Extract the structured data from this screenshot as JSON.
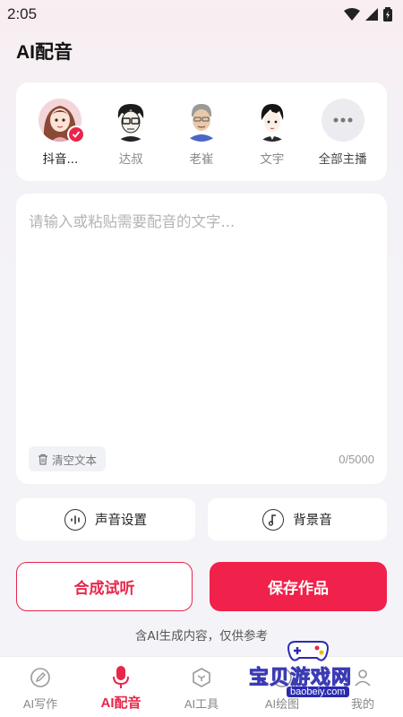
{
  "status": {
    "time": "2:05"
  },
  "header": {
    "title": "AI配音"
  },
  "voices": [
    {
      "name": "抖音...",
      "selected": true,
      "avatar": "female-anime-avatar"
    },
    {
      "name": "达叔",
      "selected": false,
      "avatar": "glasses-man-avatar"
    },
    {
      "name": "老崔",
      "selected": false,
      "avatar": "gray-hair-man-avatar"
    },
    {
      "name": "文宇",
      "selected": false,
      "avatar": "young-man-avatar"
    },
    {
      "name": "全部主播",
      "selected": false,
      "avatar": "more-icon"
    }
  ],
  "editor": {
    "placeholder": "请输入或粘贴需要配音的文字...",
    "value": "",
    "clear_label": "清空文本",
    "char_count": "0/5000"
  },
  "options": {
    "voice_settings": "声音设置",
    "background_music": "背景音"
  },
  "actions": {
    "synthesize": "合成试听",
    "save": "保存作品"
  },
  "disclaimer": "含AI生成内容，仅供参考",
  "nav": [
    {
      "label": "AI写作",
      "icon": "pen-icon",
      "active": false
    },
    {
      "label": "AI配音",
      "icon": "microphone-icon",
      "active": true
    },
    {
      "label": "AI工具",
      "icon": "box-icon",
      "active": false
    },
    {
      "label": "AI绘图",
      "icon": "paint-icon",
      "active": false
    },
    {
      "label": "我的",
      "icon": "user-icon",
      "active": false
    }
  ],
  "watermark": {
    "text": "宝贝游戏网",
    "url": "baobeiy.com"
  },
  "colors": {
    "accent": "#e8264a",
    "primary_button": "#f0214a"
  }
}
